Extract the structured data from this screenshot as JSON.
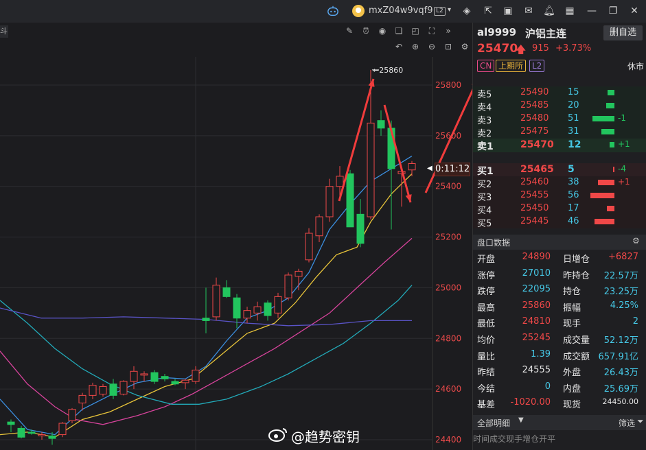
{
  "topbar": {
    "username": "mxZ04w9vqf9",
    "level_badge": "L2",
    "icons": [
      "robot-icon",
      "avatar-icon",
      "layers-icon",
      "export-icon",
      "tv-icon",
      "mail-icon",
      "bell-icon",
      "grid-icon",
      "minimize-icon",
      "restore-icon",
      "close-icon"
    ]
  },
  "chart": {
    "price_axis": [
      "25800",
      "25600",
      "25400",
      "25200",
      "25000",
      "24800",
      "24600",
      "24400"
    ],
    "high_label": "25860",
    "countdown": "0:11:12",
    "watermark": "@趋势密钥"
  },
  "quote": {
    "symbol": "al9999",
    "name": "沪铝主连",
    "remove_button": "删自选",
    "price": "25470",
    "change": "915",
    "change_pct": "+3.73%",
    "tags": [
      "CN",
      "上期所",
      "L2"
    ],
    "status": "休市"
  },
  "asks": [
    {
      "label": "卖5",
      "price": "25490",
      "vol": "15",
      "delta": ""
    },
    {
      "label": "卖4",
      "price": "25485",
      "vol": "20",
      "delta": ""
    },
    {
      "label": "卖3",
      "price": "25480",
      "vol": "51",
      "delta": "-1"
    },
    {
      "label": "卖2",
      "price": "25475",
      "vol": "31",
      "delta": ""
    },
    {
      "label": "卖1",
      "price": "25470",
      "vol": "12",
      "delta": "+1"
    }
  ],
  "bids": [
    {
      "label": "买1",
      "price": "25465",
      "vol": "5",
      "delta": "-4"
    },
    {
      "label": "买2",
      "price": "25460",
      "vol": "38",
      "delta": "+1"
    },
    {
      "label": "买3",
      "price": "25455",
      "vol": "56",
      "delta": ""
    },
    {
      "label": "买4",
      "price": "25450",
      "vol": "17",
      "delta": ""
    },
    {
      "label": "买5",
      "price": "25445",
      "vol": "46",
      "delta": ""
    }
  ],
  "panel_data_title": "盘口数据",
  "stats": [
    {
      "k1": "开盘",
      "v1": "24890",
      "k2": "日增仓",
      "v2": "+6827"
    },
    {
      "k1": "涨停",
      "v1": "27010",
      "k2": "昨持仓",
      "v2": "22.57万"
    },
    {
      "k1": "跌停",
      "v1": "22095",
      "k2": "持仓",
      "v2": "23.25万"
    },
    {
      "k1": "最高",
      "v1": "25860",
      "k2": "振幅",
      "v2": "4.25%"
    },
    {
      "k1": "最低",
      "v1": "24810",
      "k2": "现手",
      "v2": "2"
    },
    {
      "k1": "均价",
      "v1": "25245",
      "k2": "成交量",
      "v2": "52.12万"
    },
    {
      "k1": "量比",
      "v1": "1.39",
      "k2": "成交额",
      "v2": "657.91亿"
    },
    {
      "k1": "昨结",
      "v1": "24555",
      "k2": "外盘",
      "v2": "26.43万"
    },
    {
      "k1": "今结",
      "v1": "0",
      "k2": "内盘",
      "v2": "25.69万"
    },
    {
      "k1": "基差",
      "v1": "-1020.00",
      "k2": "现货",
      "v2": "24450.00"
    }
  ],
  "detail": {
    "title": "全部明细",
    "filter": "筛选",
    "columns": [
      "时间",
      "成交",
      "现手",
      "增仓",
      "开平"
    ]
  },
  "colors": {
    "up": "#f04848",
    "down": "#22c55e",
    "cyan": "#46c8e6"
  }
}
